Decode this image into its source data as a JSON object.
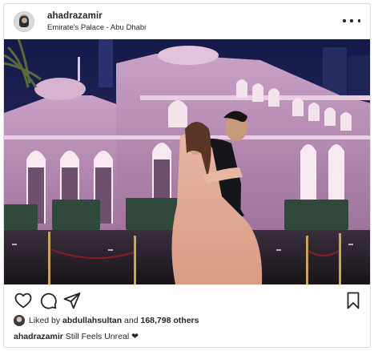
{
  "post": {
    "username": "ahadrazamir",
    "location": "Emirate's Palace - Abu Dhabi",
    "likes": {
      "prefix": "Liked by",
      "liker": "abdullahsultan",
      "suffix": "and",
      "others": "168,798 others"
    },
    "caption": {
      "username": "ahadrazamir",
      "text": "Still Feels Unreal",
      "emoji": "❤"
    }
  },
  "icons": {
    "more": "more-horizontal-icon",
    "like": "heart-icon",
    "comment": "comment-icon",
    "share": "share-paper-plane-icon",
    "save": "bookmark-icon"
  },
  "colors": {
    "text": "#262626",
    "border": "#dbdbdb",
    "sky": "#1b1f4a",
    "palace_glow": "#d9a7c8"
  }
}
